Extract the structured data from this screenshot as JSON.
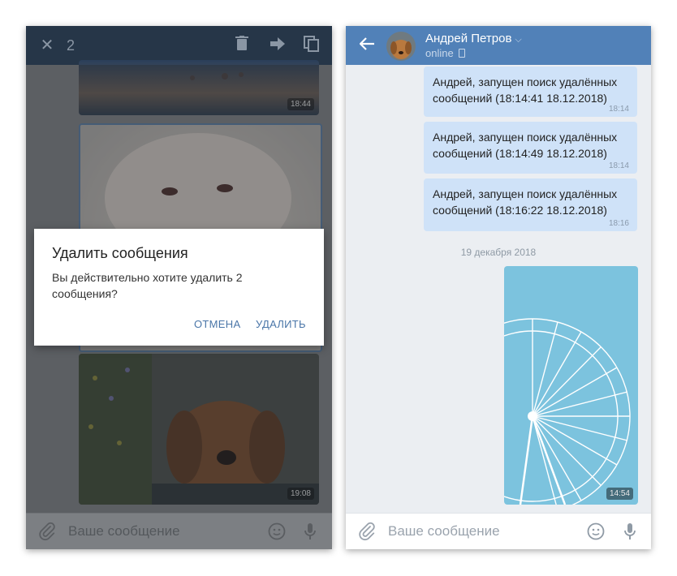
{
  "left_screen": {
    "selection_count": "2",
    "images": [
      {
        "name": "sunset-photo",
        "time": "18:44"
      },
      {
        "name": "white-fox-photo",
        "time": ""
      },
      {
        "name": "dog-photo",
        "time": "19:08"
      }
    ],
    "dialog": {
      "title": "Удалить сообщения",
      "body": "Вы действительно хотите удалить 2 сообщения?",
      "cancel": "ОТМЕНА",
      "delete": "УДАЛИТЬ"
    },
    "composer_placeholder": "Ваше сообщение"
  },
  "right_screen": {
    "contact_name": "Андрей Петров",
    "status": "online",
    "messages": [
      {
        "text": "Андрей, запущен поиск удалённых сообщений (18:14:41 18.12.2018)",
        "time": "18:14"
      },
      {
        "text": "Андрей, запущен поиск удалённых сообщений (18:14:49 18.12.2018)",
        "time": "18:14"
      },
      {
        "text": "Андрей, запущен поиск удалённых сообщений (18:16:22 18.12.2018)",
        "time": "18:16"
      }
    ],
    "date_separator": "19 декабря 2018",
    "photo_time": "14:54",
    "composer_placeholder": "Ваше сообщение"
  },
  "colors": {
    "header_blue": "#5181b8",
    "bubble_blue": "#cfe2f8",
    "dim_header": "#263648",
    "dialog_button": "#4a76a8"
  },
  "icons": [
    "close-icon",
    "trash-icon",
    "forward-icon",
    "copy-icon",
    "back-arrow-icon",
    "chevron-down-icon",
    "phone-icon",
    "paperclip-icon",
    "emoji-icon",
    "microphone-icon"
  ]
}
